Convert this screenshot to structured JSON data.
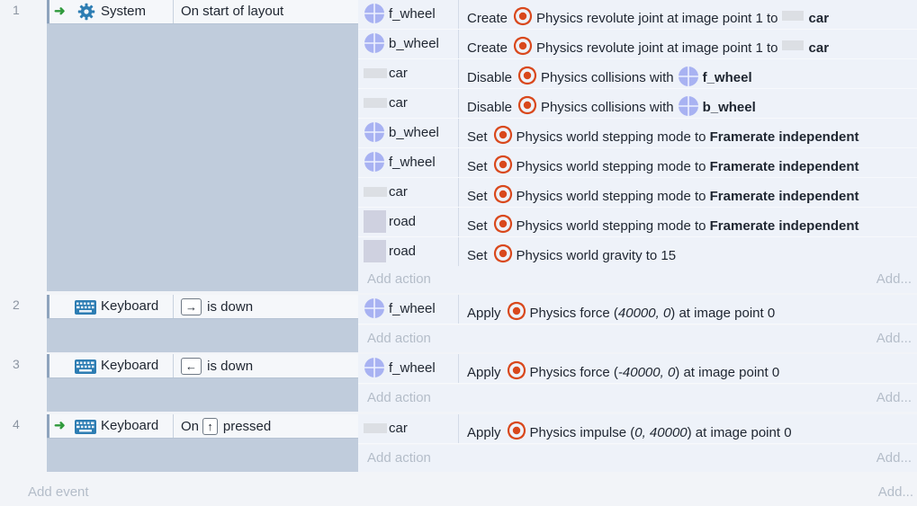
{
  "events": [
    {
      "number": "1",
      "condition": {
        "object": "System",
        "icon": "gear-icon",
        "text": "On start of layout",
        "trigger": true
      },
      "actions": [
        {
          "object": "f_wheel",
          "icon": "wheel",
          "verb": "Create",
          "behavior": "Physics",
          "pre": "revolute joint at image point 1 to",
          "target": "car",
          "target_icon": "car"
        },
        {
          "object": "b_wheel",
          "icon": "wheel",
          "verb": "Create",
          "behavior": "Physics",
          "pre": "revolute joint at image point 1 to",
          "target": "car",
          "target_icon": "car"
        },
        {
          "object": "car",
          "icon": "car",
          "verb": "Disable",
          "behavior": "Physics",
          "pre": "collisions with",
          "target": "f_wheel",
          "target_icon": "wheel"
        },
        {
          "object": "car",
          "icon": "car",
          "verb": "Disable",
          "behavior": "Physics",
          "pre": "collisions with",
          "target": "b_wheel",
          "target_icon": "wheel"
        },
        {
          "object": "b_wheel",
          "icon": "wheel",
          "verb": "Set",
          "behavior": "Physics",
          "pre": "world stepping mode to",
          "target": "Framerate independent"
        },
        {
          "object": "f_wheel",
          "icon": "wheel",
          "verb": "Set",
          "behavior": "Physics",
          "pre": "world stepping mode to",
          "target": "Framerate independent"
        },
        {
          "object": "car",
          "icon": "car",
          "verb": "Set",
          "behavior": "Physics",
          "pre": "world stepping mode to",
          "target": "Framerate independent"
        },
        {
          "object": "road",
          "icon": "road",
          "verb": "Set",
          "behavior": "Physics",
          "pre": "world stepping mode to",
          "target": "Framerate independent"
        },
        {
          "object": "road",
          "icon": "road",
          "verb": "Set",
          "behavior": "Physics",
          "pre": "world gravity to 15"
        }
      ],
      "add_action": "Add action",
      "add_more": "Add..."
    },
    {
      "number": "2",
      "condition": {
        "object": "Keyboard",
        "icon": "keyboard-icon",
        "key": "→",
        "text": "is down",
        "trigger": false
      },
      "actions": [
        {
          "object": "f_wheel",
          "icon": "wheel",
          "verb": "Apply",
          "behavior": "Physics",
          "pre": "force (",
          "param": "40000, 0",
          "post": ") at image point 0"
        }
      ],
      "add_action": "Add action",
      "add_more": "Add..."
    },
    {
      "number": "3",
      "condition": {
        "object": "Keyboard",
        "icon": "keyboard-icon",
        "key": "←",
        "text": "is down",
        "trigger": false
      },
      "actions": [
        {
          "object": "f_wheel",
          "icon": "wheel",
          "verb": "Apply",
          "behavior": "Physics",
          "pre": "force (",
          "param": "-40000, 0",
          "post": ") at image point 0"
        }
      ],
      "add_action": "Add action",
      "add_more": "Add..."
    },
    {
      "number": "4",
      "condition": {
        "object": "Keyboard",
        "icon": "keyboard-icon",
        "prefix": "On",
        "key": "↑",
        "text": "pressed",
        "trigger": true
      },
      "actions": [
        {
          "object": "car",
          "icon": "car",
          "verb": "Apply",
          "behavior": "Physics",
          "pre": "impulse (",
          "param": "0, 40000",
          "post": ") at image point 0"
        }
      ],
      "add_action": "Add action",
      "add_more": "Add..."
    }
  ],
  "footer": {
    "add_event": "Add event",
    "add_more": "Add..."
  },
  "colors": {
    "condition_bg": "#c0ccdc",
    "action_bg": "#eef2f9",
    "trigger_arrow": "#2f9a3c",
    "physics_icon": "#d9481c",
    "wheel_icon": "#9aa6f0"
  }
}
